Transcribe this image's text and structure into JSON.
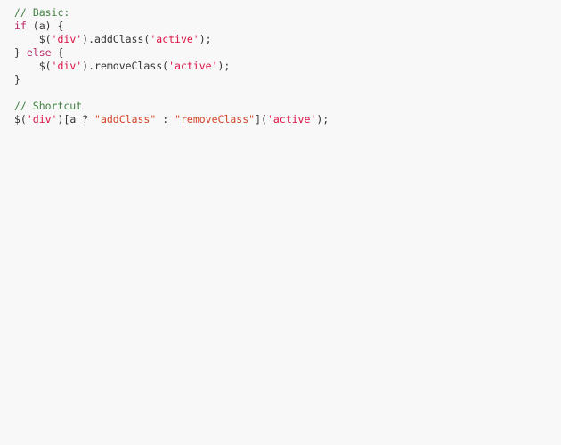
{
  "viewer": {
    "name": "code-snippet-viewer",
    "background_color": "#f8f8f8",
    "language": "javascript"
  },
  "theme": {
    "comment_color": "#408040",
    "keyword_color": "#bb2a6b",
    "string_color": "#dd1144",
    "double_string_color": "#d14326",
    "plain_color": "#333333"
  },
  "code": {
    "lines": [
      {
        "index": 1,
        "text": "// Basic:",
        "tokens": [
          {
            "t": "// Basic:",
            "c": "comment"
          }
        ]
      },
      {
        "index": 2,
        "text": "if (a) {",
        "tokens": [
          {
            "t": "if",
            "c": "keyword"
          },
          {
            "t": " (a) {",
            "c": "plain"
          }
        ]
      },
      {
        "index": 3,
        "text": "    $('div').addClass('active');",
        "tokens": [
          {
            "t": "    $(",
            "c": "plain"
          },
          {
            "t": "'div'",
            "c": "string"
          },
          {
            "t": ").addClass(",
            "c": "plain"
          },
          {
            "t": "'active'",
            "c": "string"
          },
          {
            "t": ");",
            "c": "plain"
          }
        ]
      },
      {
        "index": 4,
        "text": "} else {",
        "tokens": [
          {
            "t": "} ",
            "c": "plain"
          },
          {
            "t": "else",
            "c": "keyword"
          },
          {
            "t": " {",
            "c": "plain"
          }
        ]
      },
      {
        "index": 5,
        "text": "    $('div').removeClass('active');",
        "tokens": [
          {
            "t": "    $(",
            "c": "plain"
          },
          {
            "t": "'div'",
            "c": "string"
          },
          {
            "t": ").removeClass(",
            "c": "plain"
          },
          {
            "t": "'active'",
            "c": "string"
          },
          {
            "t": ");",
            "c": "plain"
          }
        ]
      },
      {
        "index": 6,
        "text": "}",
        "tokens": [
          {
            "t": "}",
            "c": "plain"
          }
        ]
      },
      {
        "index": 7,
        "text": "",
        "tokens": []
      },
      {
        "index": 8,
        "text": "// Shortcut",
        "tokens": [
          {
            "t": "// Shortcut",
            "c": "comment"
          }
        ]
      },
      {
        "index": 9,
        "text": "$('div')[a ? \"addClass\" : \"removeClass\"]('active');",
        "tokens": [
          {
            "t": "$(",
            "c": "plain"
          },
          {
            "t": "'div'",
            "c": "string"
          },
          {
            "t": ")[a ? ",
            "c": "plain"
          },
          {
            "t": "\"addClass\"",
            "c": "dstring"
          },
          {
            "t": " : ",
            "c": "plain"
          },
          {
            "t": "\"removeClass\"",
            "c": "dstring"
          },
          {
            "t": "](",
            "c": "plain"
          },
          {
            "t": "'active'",
            "c": "string"
          },
          {
            "t": ");",
            "c": "plain"
          }
        ]
      }
    ]
  }
}
